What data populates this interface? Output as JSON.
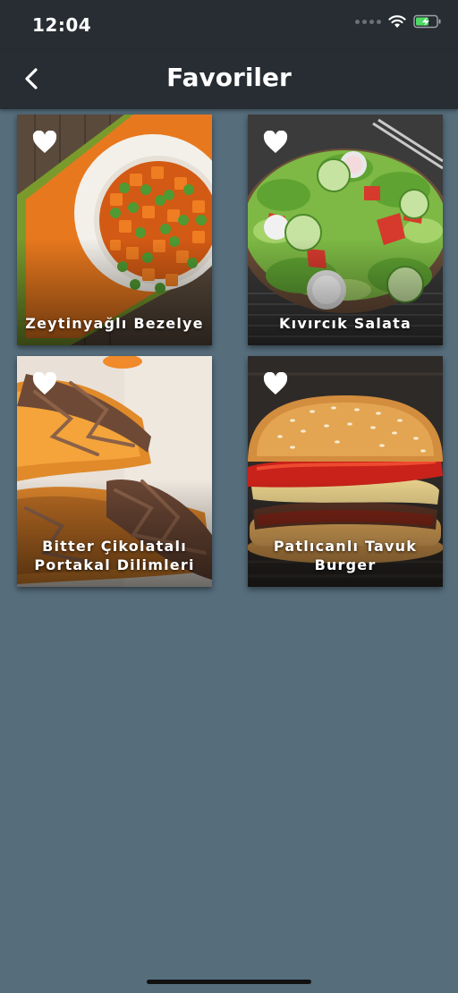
{
  "status_bar": {
    "time": "12:04"
  },
  "header": {
    "title": "Favoriler",
    "back_icon": "chevron-left-icon"
  },
  "favorites": [
    {
      "title": "Zeytinyağlı Bezelye",
      "favorited": true
    },
    {
      "title": "Kıvırcık Salata",
      "favorited": true
    },
    {
      "title": "Bitter Çikolatalı Portakal Dilimleri",
      "favorited": true
    },
    {
      "title": "Patlıcanlı Tavuk Burger",
      "favorited": true
    }
  ],
  "colors": {
    "background": "#566d7c",
    "bar": "#272d33",
    "text": "#ffffff"
  }
}
